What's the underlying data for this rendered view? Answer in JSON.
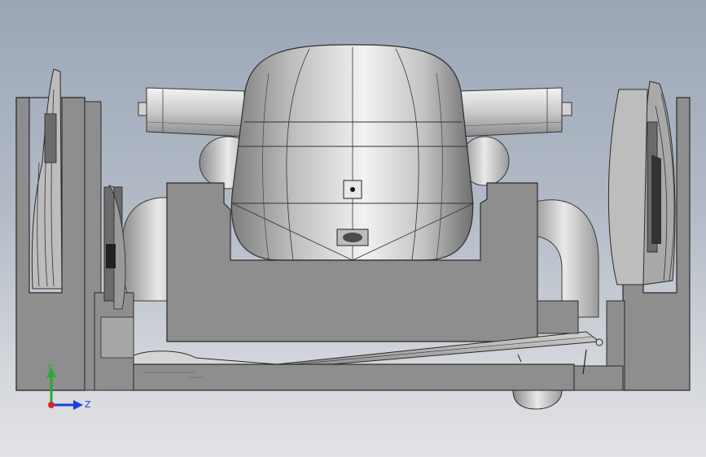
{
  "viewport": {
    "background_top": "#9ba6b6",
    "background_bottom": "#e2e3e6",
    "model_color": "#8e8e8e",
    "shell_color": "#d9d9d9"
  },
  "triad": {
    "y_label": "Y",
    "z_label": "Z",
    "y_color": "#2fa82f",
    "z_color": "#1f3fd8",
    "x_color": "#d8232a"
  }
}
